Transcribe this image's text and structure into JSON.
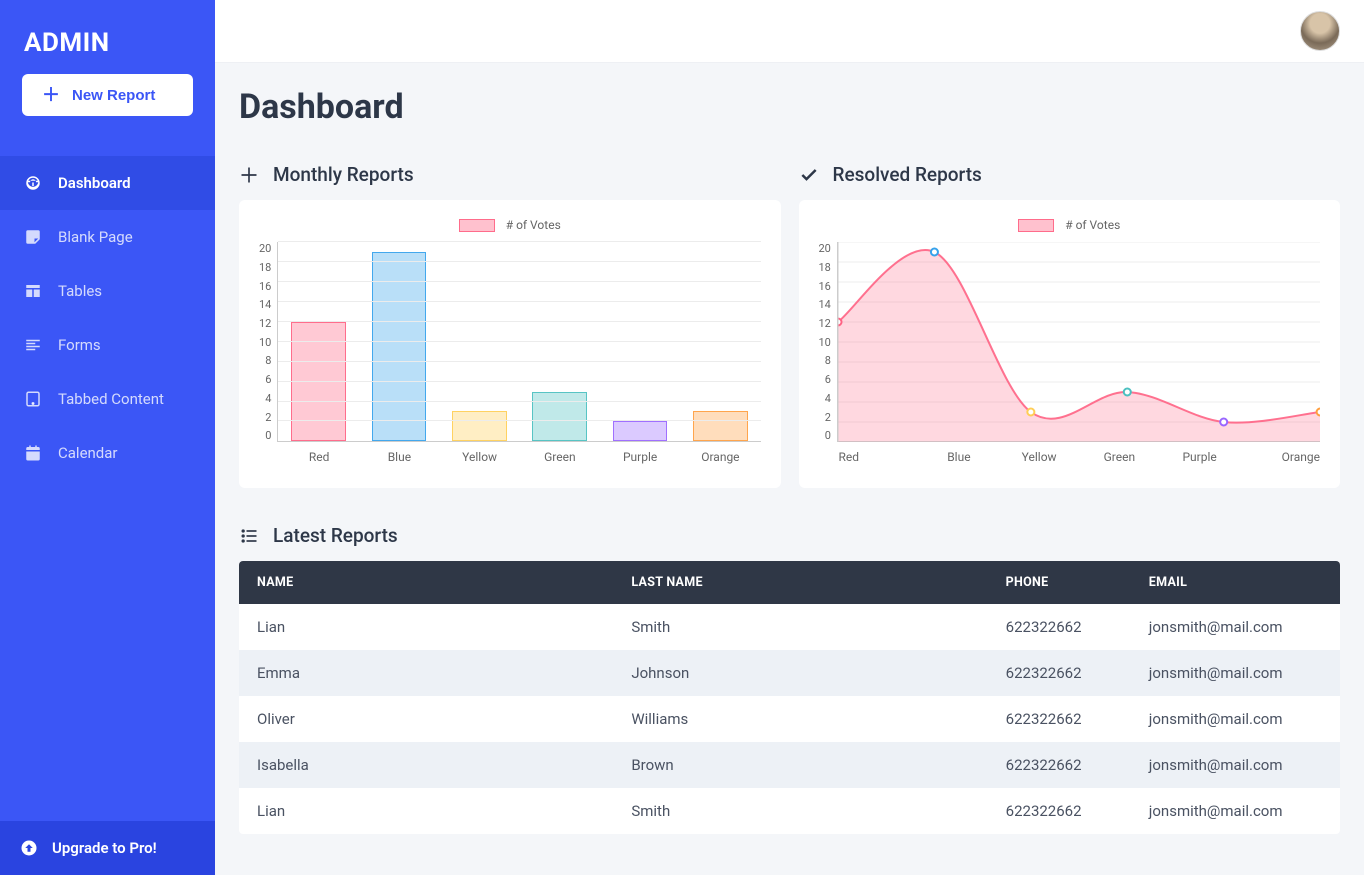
{
  "brand": "ADMIN",
  "new_report_label": "New Report",
  "sidebar": {
    "items": [
      {
        "label": "Dashboard",
        "icon": "dashboard-icon",
        "active": true
      },
      {
        "label": "Blank Page",
        "icon": "sticky-note-icon",
        "active": false
      },
      {
        "label": "Tables",
        "icon": "table-icon",
        "active": false
      },
      {
        "label": "Forms",
        "icon": "align-left-icon",
        "active": false
      },
      {
        "label": "Tabbed Content",
        "icon": "tablet-icon",
        "active": false
      },
      {
        "label": "Calendar",
        "icon": "calendar-icon",
        "active": false
      }
    ]
  },
  "upgrade_label": "Upgrade to Pro!",
  "page_title": "Dashboard",
  "monthly": {
    "title": "Monthly Reports",
    "chart_data": {
      "type": "bar",
      "legend": "# of Votes",
      "categories": [
        "Red",
        "Blue",
        "Yellow",
        "Green",
        "Purple",
        "Orange"
      ],
      "values": [
        12,
        19,
        3,
        5,
        2,
        3
      ],
      "yticks": [
        0,
        2,
        4,
        6,
        8,
        10,
        12,
        14,
        16,
        18,
        20
      ],
      "ylim": [
        0,
        20
      ],
      "colors": [
        {
          "fill": "rgba(255,99,132,0.35)",
          "border": "rgba(255,99,132,0.9)"
        },
        {
          "fill": "rgba(54,162,235,0.35)",
          "border": "rgba(54,162,235,0.9)"
        },
        {
          "fill": "rgba(255,206,86,0.35)",
          "border": "rgba(255,206,86,0.9)"
        },
        {
          "fill": "rgba(75,192,192,0.35)",
          "border": "rgba(75,192,192,0.9)"
        },
        {
          "fill": "rgba(153,102,255,0.35)",
          "border": "rgba(153,102,255,0.9)"
        },
        {
          "fill": "rgba(255,159,64,0.35)",
          "border": "rgba(255,159,64,0.9)"
        }
      ]
    }
  },
  "resolved": {
    "title": "Resolved Reports",
    "chart_data": {
      "type": "line",
      "legend": "# of Votes",
      "categories": [
        "Red",
        "Blue",
        "Yellow",
        "Green",
        "Purple",
        "Orange"
      ],
      "values": [
        12,
        19,
        3,
        5,
        2,
        3
      ],
      "yticks": [
        0,
        2,
        4,
        6,
        8,
        10,
        12,
        14,
        16,
        18,
        20
      ],
      "ylim": [
        0,
        20
      ],
      "point_colors": [
        "rgba(255,99,132,1)",
        "rgba(54,162,235,1)",
        "rgba(255,206,86,1)",
        "rgba(75,192,192,1)",
        "rgba(153,102,255,1)",
        "rgba(255,159,64,1)"
      ],
      "line_color": "rgba(255,99,132,0.9)",
      "fill_color": "rgba(255,99,132,0.25)"
    }
  },
  "latest": {
    "title": "Latest Reports",
    "headers": [
      "NAME",
      "LAST NAME",
      "PHONE",
      "EMAIL"
    ],
    "rows": [
      {
        "name": "Lian",
        "last": "Smith",
        "phone": "622322662",
        "email": "jonsmith@mail.com"
      },
      {
        "name": "Emma",
        "last": "Johnson",
        "phone": "622322662",
        "email": "jonsmith@mail.com"
      },
      {
        "name": "Oliver",
        "last": "Williams",
        "phone": "622322662",
        "email": "jonsmith@mail.com"
      },
      {
        "name": "Isabella",
        "last": "Brown",
        "phone": "622322662",
        "email": "jonsmith@mail.com"
      },
      {
        "name": "Lian",
        "last": "Smith",
        "phone": "622322662",
        "email": "jonsmith@mail.com"
      }
    ]
  },
  "chart_data": [
    {
      "type": "bar",
      "title": "Monthly Reports",
      "categories": [
        "Red",
        "Blue",
        "Yellow",
        "Green",
        "Purple",
        "Orange"
      ],
      "series": [
        {
          "name": "# of Votes",
          "values": [
            12,
            19,
            3,
            5,
            2,
            3
          ]
        }
      ],
      "ylim": [
        0,
        20
      ],
      "xlabel": "",
      "ylabel": ""
    },
    {
      "type": "line",
      "title": "Resolved Reports",
      "categories": [
        "Red",
        "Blue",
        "Yellow",
        "Green",
        "Purple",
        "Orange"
      ],
      "series": [
        {
          "name": "# of Votes",
          "values": [
            12,
            19,
            3,
            5,
            2,
            3
          ]
        }
      ],
      "ylim": [
        0,
        20
      ],
      "xlabel": "",
      "ylabel": ""
    }
  ]
}
